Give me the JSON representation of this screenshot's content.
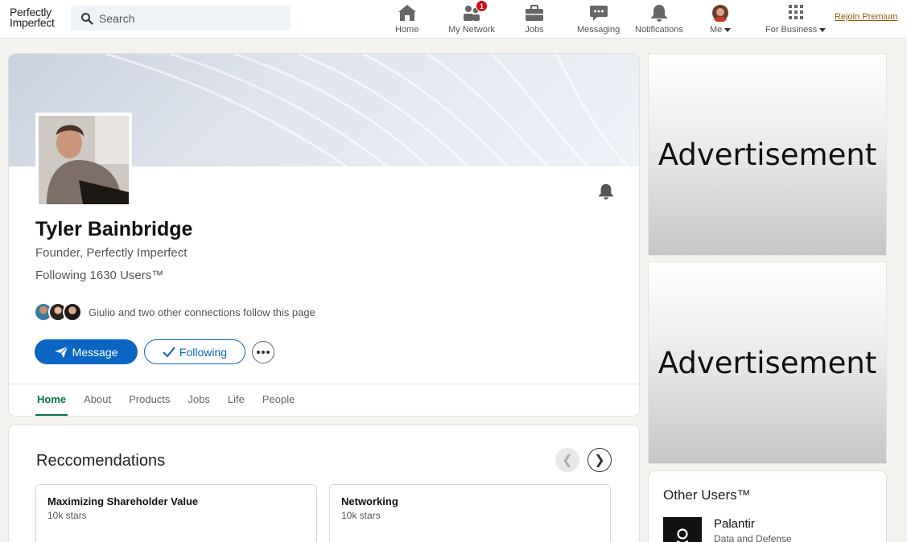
{
  "nav": {
    "logo_line1": "Perfectly",
    "logo_line2": "Imperfect",
    "search_placeholder": "Search",
    "items": [
      {
        "label": "Home",
        "icon": "home-icon"
      },
      {
        "label": "My Network",
        "icon": "network-icon",
        "badge": "1"
      },
      {
        "label": "Jobs",
        "icon": "briefcase-icon"
      },
      {
        "label": "Messaging",
        "icon": "chat-icon"
      },
      {
        "label": "Notifications",
        "icon": "bell-icon"
      },
      {
        "label": "Me",
        "icon": "avatar"
      },
      {
        "label": "For Business",
        "icon": "grid-icon"
      }
    ],
    "premium_label": "Rejoin Premium"
  },
  "profile": {
    "name": "Tyler Bainbridge",
    "tagline": "Founder, Perfectly Imperfect",
    "following": "Following 1630 Users™",
    "connections_text": "Giulio and two other connections follow this page",
    "message_label": "Message",
    "following_label": "Following",
    "tabs": [
      "Home",
      "About",
      "Products",
      "Jobs",
      "Life",
      "People"
    ],
    "active_tab": "Home"
  },
  "recommendations": {
    "title": "Reccomendations",
    "cards": [
      {
        "title": "Maximizing Shareholder Value",
        "stars": "10k stars"
      },
      {
        "title": "Networking",
        "stars": "10k stars"
      }
    ]
  },
  "ads": {
    "ad1": "Advertisement",
    "ad2": "Advertisement"
  },
  "other_users": {
    "title": "Other Users™",
    "items": [
      {
        "name": "Palantir",
        "subtitle": "Data and Defense"
      }
    ]
  },
  "colors": {
    "primary": "#0a66c2",
    "active_tab": "#057642",
    "badge": "#cc1016",
    "premium": "#915907"
  }
}
